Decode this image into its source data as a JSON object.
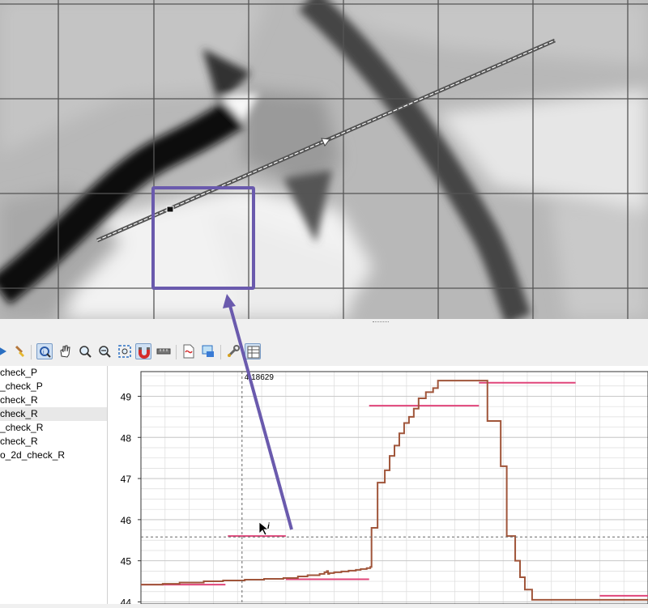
{
  "toolbar": {
    "buttons": [
      {
        "icon": "arrow-right-icon"
      },
      {
        "icon": "brush-icon"
      },
      {
        "icon": "identify-icon",
        "active": true
      },
      {
        "icon": "pan-hand-icon"
      },
      {
        "icon": "zoom-in-icon"
      },
      {
        "icon": "zoom-out-icon"
      },
      {
        "icon": "zoom-full-icon"
      },
      {
        "icon": "magnet-icon",
        "active": true
      },
      {
        "icon": "ruler-icon"
      },
      {
        "icon": "export-pdf-icon"
      },
      {
        "icon": "export-image-icon"
      },
      {
        "icon": "settings-wrench-icon"
      },
      {
        "icon": "table-icon"
      }
    ]
  },
  "layers": [
    {
      "label": "check_P"
    },
    {
      "label": "_check_P"
    },
    {
      "label": "check_R"
    },
    {
      "label": "check_R",
      "selected": true
    },
    {
      "label": "_check_R"
    },
    {
      "label": "check_R"
    },
    {
      "label": "o_2d_check_R"
    }
  ],
  "colors": {
    "profile": "#a0553a",
    "reference": "#e0457a",
    "annotation": "#6a5aad",
    "grid": "#dcdcdc"
  },
  "crosshair": {
    "x_readout": "4.18629",
    "y_value": 45.58
  },
  "chart_data": {
    "type": "line",
    "title": "",
    "xlabel": "",
    "ylabel": "",
    "ylim": [
      43.95,
      49.6
    ],
    "y_ticks": [
      "49",
      "48",
      "47",
      "46",
      "45",
      "44"
    ],
    "y_tick_values": [
      49,
      48,
      47,
      46,
      45,
      44
    ],
    "x_range": [
      0,
      21
    ],
    "series": [
      {
        "kind": "profile",
        "x": [
          0,
          0.8,
          1.5,
          2.5,
          3.2,
          4.2,
          5.0,
          5.9,
          6.5,
          6.9,
          7.6,
          8.2,
          8.6,
          8.9,
          9.45,
          9.5,
          9.9,
          10.1,
          10.4,
          10.7,
          11.0,
          11.3,
          11.6,
          11.9,
          12.2,
          12.5,
          12.8,
          13.3,
          14.0,
          14.4,
          14.6,
          14.9,
          15.1,
          15.4,
          15.7,
          15.9,
          16.2,
          16.6,
          17.6,
          18.0,
          18.2,
          19.2,
          20.0
        ],
        "y": [
          44.42,
          44.45,
          44.48,
          44.5,
          44.52,
          44.54,
          44.56,
          44.6,
          44.62,
          44.65,
          44.7,
          44.72,
          44.75,
          44.78,
          44.82,
          45.8,
          46.9,
          47.5,
          47.9,
          48.15,
          48.5,
          48.8,
          49.1,
          49.2,
          49.3,
          49.38,
          49.38,
          49.38,
          49.38,
          48.4,
          47.3,
          46.4,
          45.5,
          45.0,
          44.6,
          44.3,
          44.1,
          44.0,
          44.0,
          44.0,
          44.0,
          44.0,
          44.0
        ],
        "x_full": [
          0,
          0.9,
          1.6,
          2.6,
          3.4,
          4.3,
          5.1,
          5.9,
          6.5,
          6.9,
          7.4,
          7.6,
          7.7,
          7.75,
          7.8,
          8.0,
          8.3,
          8.6,
          8.9,
          9.1,
          9.35,
          9.5,
          9.55,
          9.8,
          10.1,
          10.3,
          10.5,
          10.7,
          10.9,
          11.1,
          11.3,
          11.5,
          11.8,
          12.1,
          12.3,
          12.8,
          13.3,
          13.7,
          14.1,
          14.3,
          14.35,
          14.8,
          14.9,
          15.15,
          15.5,
          15.7,
          15.9,
          16.2,
          17.0,
          17.8,
          18.1,
          18.6,
          19.2,
          21.0
        ],
        "y_full": [
          44.42,
          44.44,
          44.47,
          44.5,
          44.52,
          44.54,
          44.56,
          44.58,
          44.62,
          44.65,
          44.68,
          44.72,
          44.75,
          44.68,
          44.7,
          44.72,
          44.74,
          44.76,
          44.78,
          44.8,
          44.82,
          44.85,
          45.8,
          46.9,
          47.2,
          47.55,
          47.8,
          48.1,
          48.35,
          48.5,
          48.7,
          48.95,
          49.1,
          49.2,
          49.38,
          49.38,
          49.38,
          49.38,
          49.38,
          49.38,
          48.4,
          48.4,
          47.3,
          45.6,
          45.0,
          44.6,
          44.3,
          44.05,
          44.05,
          44.05,
          44.05,
          44.05,
          44.05,
          44.05
        ]
      },
      {
        "kind": "reference",
        "segments": [
          {
            "x0": 0.0,
            "x1": 3.5,
            "y": 44.42
          },
          {
            "x0": 3.6,
            "x1": 6.0,
            "y": 45.6
          },
          {
            "x0": 6.0,
            "x1": 9.45,
            "y": 44.55
          },
          {
            "x0": 9.45,
            "x1": 14.0,
            "y": 48.77
          },
          {
            "x0": 14.0,
            "x1": 18.0,
            "y": 49.33
          },
          {
            "x0": 19.0,
            "x1": 21.0,
            "y": 44.15
          }
        ]
      }
    ]
  }
}
